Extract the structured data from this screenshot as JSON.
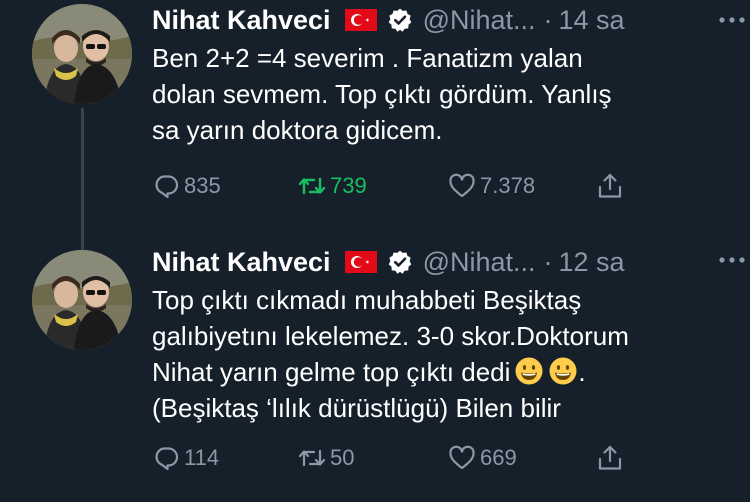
{
  "tweets": [
    {
      "display_name": "Nihat Kahveci",
      "handle": "@Nihat...",
      "separator": "·",
      "time": "14 sa",
      "flag_icon": "turkey-flag-icon",
      "verified_icon": "verified-badge-icon",
      "text_lines": [
        "Ben 2+2 =4 severim . Fanatizm  yalan",
        "dolan sevmem. Top çıktı gördüm. Yanlış",
        "sa yarın doktora gidicem."
      ],
      "replies": "835",
      "retweets": "739",
      "likes": "7.378",
      "retweeted": true
    },
    {
      "display_name": "Nihat Kahveci",
      "handle": "@Nihat...",
      "separator": "·",
      "time": "12 sa",
      "flag_icon": "turkey-flag-icon",
      "verified_icon": "verified-badge-icon",
      "text_lines": [
        "Top çıktı cıkmadı muhabbeti Beşiktaş",
        "galıbiyetını lekelemez. 3-0 skor.Doktorum",
        "Nihat yarın gelme top çıktı dedi",
        "(Beşiktaş ‘lılık dürüstlügü) Bilen bilir"
      ],
      "line3_suffix": ".",
      "replies": "114",
      "retweets": "50",
      "likes": "669",
      "retweeted": false
    }
  ],
  "colors": {
    "background": "#15202b",
    "text": "#ffffff",
    "secondary": "#8b98a5",
    "retweet_active": "#17bf63",
    "verified_badge": "#ffffff",
    "flag_red": "#e30a17"
  }
}
